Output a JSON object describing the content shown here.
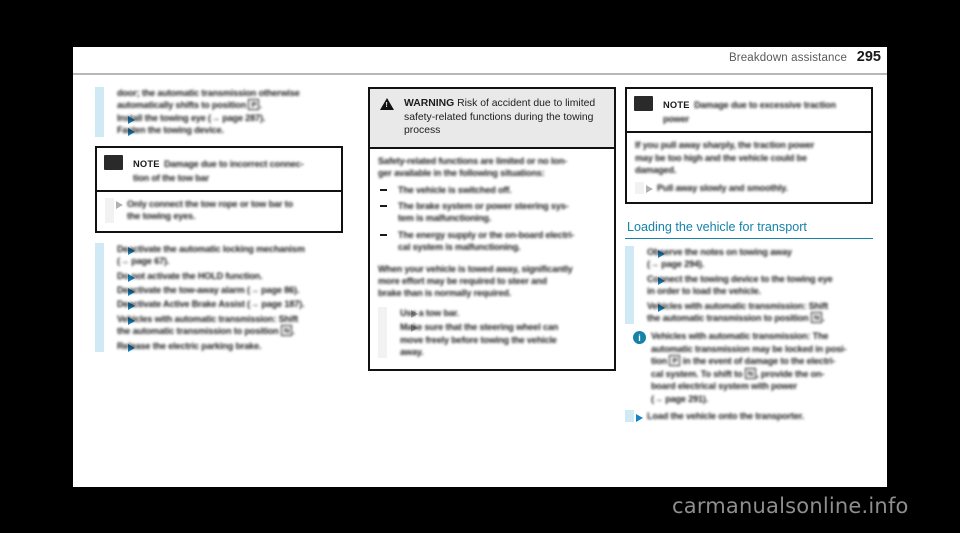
{
  "header": {
    "section_title": "Breakdown assistance",
    "page_number": "295"
  },
  "left_column": {
    "continued_paragraph": {
      "line1": "door; the automatic transmission otherwise",
      "line2": "automatically shifts to position",
      "glyph": "P",
      "line2_end": "."
    },
    "bullets_top": [
      "Install the towing eye (→ page 287).",
      "Fasten the towing device."
    ],
    "note_box": {
      "icon_name": "note-icon",
      "label": "NOTE",
      "title_line1": "Damage due to incorrect connec-",
      "title_line2": "tion of the tow bar",
      "body_line1": "Only connect the tow rope or tow bar to",
      "body_line2": "the towing eyes."
    },
    "bullets_bottom": [
      {
        "line1": "Deactivate the automatic locking mechanism",
        "line2": "(→ page 67)."
      },
      {
        "line1": "Do not activate the HOLD function."
      },
      {
        "line1": "Deactivate the tow-away alarm (→ page 86)."
      },
      {
        "line1": "Deactivate Active Brake Assist (→ page 187)."
      },
      {
        "line1": "Vehicles with automatic transmission: Shift",
        "line2_pre": "the automatic transmission to position",
        "glyph": "N",
        "line2_post": "."
      },
      {
        "line1": "Release the electric parking brake."
      }
    ]
  },
  "middle_column": {
    "warning_box": {
      "icon_name": "warning-triangle-icon",
      "label": "WARNING",
      "title_rest_line1": "Risk of accident due to limited",
      "title_line2": "safety-related functions during the towing",
      "title_line3": "process",
      "intro_line1": "Safety-related functions are limited or no lon-",
      "intro_line2": "ger available in the following situations:",
      "dash_items": [
        {
          "line1": "The vehicle is switched off."
        },
        {
          "line1": "The brake system or power steering sys-",
          "line2": "tem is malfunctioning."
        },
        {
          "line1": "The energy supply or the on-board electri-",
          "line2": "cal system is malfunctioning."
        }
      ],
      "para_line1": "When your vehicle is towed away, significantly",
      "para_line2": "more effort may be required to steer and",
      "para_line3": "brake than is normally required.",
      "arrow_items": [
        {
          "line1": "Use a tow bar."
        },
        {
          "line1": "Make sure that the steering wheel can",
          "line2": "move freely before towing the vehicle",
          "line3": "away."
        }
      ]
    }
  },
  "right_column": {
    "note_box": {
      "icon_name": "note-icon",
      "label": "NOTE",
      "title_line1": "Damage due to excessive traction",
      "title_line2": "power",
      "body_line1": "If you pull away sharply, the traction power",
      "body_line2": "may be too high and the vehicle could be",
      "body_line3": "damaged.",
      "bullet": "Pull away slowly and smoothly."
    },
    "section_heading": "Loading the vehicle for transport",
    "bullets": [
      {
        "line1": "Observe the notes on towing away",
        "line2": "(→ page 294)."
      },
      {
        "line1": "Connect the towing device to the towing eye",
        "line2": "in order to load the vehicle."
      },
      {
        "line1": "Vehicles with automatic transmission: Shift",
        "line2_pre": "the automatic transmission to position",
        "glyph": "N",
        "line2_post": "."
      }
    ],
    "info_note": {
      "icon_name": "info-circle-icon",
      "line1": "Vehicles with automatic transmission: The",
      "line2": "automatic transmission may be locked in posi-",
      "line3_pre": "tion",
      "glyph1": "P",
      "line3_post": "in the event of damage to the electri-",
      "line4_pre": "cal system. To shift to",
      "glyph2": "N",
      "line4_post": ", provide the on-",
      "line5": "board electrical system with power",
      "line6": "(→ page 291)."
    },
    "final_bullet": "Load the vehicle onto the transporter."
  },
  "watermark": {
    "text": "carmanualsonline.info"
  },
  "colors": {
    "accent_blue": "#1583a8",
    "arrow_blue": "#1583c4",
    "side_bar": "#cfe9f5",
    "warning_bg": "#e9e9e9",
    "page_bg": "#ffffff",
    "frame": "#000000"
  }
}
